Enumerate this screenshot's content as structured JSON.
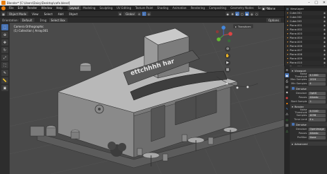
{
  "window": {
    "title": "Blender* [C:\\Users\\Daisy\\Desktop\\cafe.blend]",
    "controls": [
      "–",
      "□",
      "✕"
    ]
  },
  "menu": {
    "items": [
      "File",
      "Edit",
      "Render",
      "Window",
      "Help"
    ],
    "workspaces": [
      "Layout",
      "Modeling",
      "Sculpting",
      "UV Editing",
      "Texture Paint",
      "Shading",
      "Animation",
      "Rendering",
      "Compositing",
      "Geometry Nodes",
      "Scripting"
    ],
    "active_workspace": "Layout",
    "scene_label": "Scene",
    "view_layer_label": "ViewLayer"
  },
  "tool_header": {
    "mode": "Object Mode",
    "view": "View",
    "select": "Select",
    "add": "Add",
    "object": "Object",
    "orientation": "Global",
    "options": "Options"
  },
  "viewport_header": {
    "orientation_label": "Orientation:",
    "orientation_value": "Default",
    "drag_label": "Drag:",
    "drag_value": "Select Box"
  },
  "overlay_text": {
    "camera": "Camera Orthographic",
    "collection": "(1) Collection | Array.001",
    "transform": "Transform"
  },
  "scene": {
    "sign_text": "ettchhhh har"
  },
  "outliner": {
    "items": [
      "Cube.001",
      "Cube.002",
      "Cube.003",
      "Plane.001",
      "Plane.002",
      "Plane.003",
      "Plane.004",
      "Plane.005",
      "Plane.006",
      "Plane.007",
      "Plane.008",
      "Plane.009",
      "Plane.010",
      "Plane.011"
    ]
  },
  "properties": {
    "tabs": [
      "tool",
      "render",
      "output",
      "view-layer",
      "scene",
      "world",
      "object",
      "modifiers",
      "particles",
      "physics",
      "constraints",
      "data"
    ],
    "sections": [
      {
        "header": "Viewport",
        "rows": [
          {
            "label": "Noise Threshold",
            "value": "0.1000"
          },
          {
            "label": "Max Samples",
            "value": "1024"
          },
          {
            "label": "Min Samples",
            "value": "0"
          }
        ]
      },
      {
        "header": "Denoise",
        "rows": [
          {
            "label": "Denoiser",
            "value": "OptiX"
          },
          {
            "label": "Passes",
            "value": "Albedo"
          },
          {
            "label": "Start Sample",
            "value": "1"
          }
        ]
      },
      {
        "header": "Render",
        "rows": [
          {
            "label": "Noise Threshold",
            "value": "0.0100"
          },
          {
            "label": "Samples",
            "value": "4096"
          },
          {
            "label": "Time Limit",
            "value": "0 s"
          }
        ]
      },
      {
        "header": "Denoise",
        "rows": [
          {
            "label": "Denoiser",
            "value": "OpenImage"
          },
          {
            "label": "Passes",
            "value": "Albedo"
          },
          {
            "label": "Prefilter",
            "value": "None"
          }
        ]
      }
    ],
    "footer": "Advanced"
  },
  "colors": {
    "accent": "#4772b3",
    "orange": "#e87d0d",
    "viewport_bg": "#4a4a4a"
  }
}
